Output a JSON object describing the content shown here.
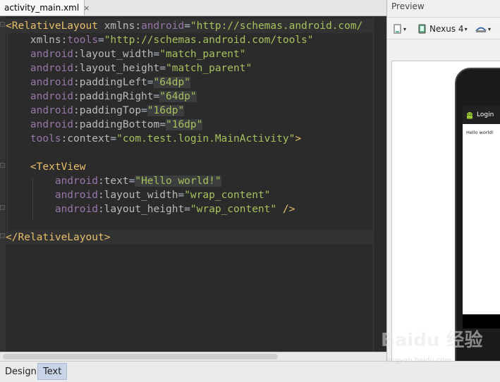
{
  "editor": {
    "tab_label": "activity_main.xml",
    "close_glyph": "×",
    "lines": [
      {
        "parts": [
          [
            "punc",
            "<"
          ],
          [
            "tagname",
            "RelativeLayout"
          ],
          [
            "plain",
            " "
          ],
          [
            "attr",
            "xmlns:"
          ],
          [
            "attr-ns",
            "android"
          ],
          [
            "plain",
            "="
          ],
          [
            "val",
            "\"http://schemas.android.com/"
          ]
        ]
      },
      {
        "parts": [
          [
            "plain",
            "    "
          ],
          [
            "attr",
            "xmlns:"
          ],
          [
            "attr-ns",
            "tools"
          ],
          [
            "plain",
            "="
          ],
          [
            "val",
            "\"http://schemas.android.com/tools\""
          ]
        ]
      },
      {
        "parts": [
          [
            "plain",
            "    "
          ],
          [
            "attr-ns",
            "android"
          ],
          [
            "attr",
            ":layout_width"
          ],
          [
            "plain",
            "="
          ],
          [
            "val",
            "\"match_parent\""
          ]
        ]
      },
      {
        "parts": [
          [
            "plain",
            "    "
          ],
          [
            "attr-ns",
            "android"
          ],
          [
            "attr",
            ":layout_height"
          ],
          [
            "plain",
            "="
          ],
          [
            "val",
            "\"match_parent\""
          ]
        ]
      },
      {
        "parts": [
          [
            "plain",
            "    "
          ],
          [
            "attr-ns",
            "android"
          ],
          [
            "attr",
            ":paddingLeft"
          ],
          [
            "plain",
            "="
          ],
          [
            "val",
            "\"64dp\""
          ]
        ]
      },
      {
        "parts": [
          [
            "plain",
            "    "
          ],
          [
            "attr-ns",
            "android"
          ],
          [
            "attr",
            ":paddingRight"
          ],
          [
            "plain",
            "="
          ],
          [
            "val",
            "\"64dp\""
          ]
        ]
      },
      {
        "parts": [
          [
            "plain",
            "    "
          ],
          [
            "attr-ns",
            "android"
          ],
          [
            "attr",
            ":paddingTop"
          ],
          [
            "plain",
            "="
          ],
          [
            "val",
            "\"16dp\""
          ]
        ]
      },
      {
        "parts": [
          [
            "plain",
            "    "
          ],
          [
            "attr-ns",
            "android"
          ],
          [
            "attr",
            ":paddingBottom"
          ],
          [
            "plain",
            "="
          ],
          [
            "val",
            "\"16dp\""
          ]
        ]
      },
      {
        "parts": [
          [
            "plain",
            "    "
          ],
          [
            "attr-ns",
            "tools"
          ],
          [
            "attr",
            ":context"
          ],
          [
            "plain",
            "="
          ],
          [
            "val",
            "\"com.test.login.MainActivity\""
          ],
          [
            "punc",
            ">"
          ]
        ]
      },
      {
        "parts": [
          [
            "plain",
            " "
          ]
        ]
      },
      {
        "parts": [
          [
            "plain",
            "    "
          ],
          [
            "punc",
            "<"
          ],
          [
            "tagname",
            "TextView"
          ]
        ]
      },
      {
        "parts": [
          [
            "plain",
            "        "
          ],
          [
            "attr-ns",
            "android"
          ],
          [
            "attr",
            ":text"
          ],
          [
            "plain",
            "="
          ],
          [
            "val",
            "\"Hello world!\""
          ]
        ]
      },
      {
        "parts": [
          [
            "plain",
            "        "
          ],
          [
            "attr-ns",
            "android"
          ],
          [
            "attr",
            ":layout_width"
          ],
          [
            "plain",
            "="
          ],
          [
            "val",
            "\"wrap_content\""
          ]
        ]
      },
      {
        "parts": [
          [
            "plain",
            "        "
          ],
          [
            "attr-ns",
            "android"
          ],
          [
            "attr",
            ":layout_height"
          ],
          [
            "plain",
            "="
          ],
          [
            "val",
            "\"wrap_content\""
          ],
          [
            "plain",
            " "
          ],
          [
            "punc",
            "/>"
          ]
        ]
      },
      {
        "parts": [
          [
            "plain",
            " "
          ]
        ]
      },
      {
        "parts": [
          [
            "punc",
            "</"
          ],
          [
            "tagname",
            "RelativeLayout"
          ],
          [
            "punc",
            ">"
          ]
        ]
      }
    ]
  },
  "preview": {
    "title": "Preview",
    "device_label": "Nexus 4",
    "app_title": "Login",
    "hello_text": "Hello world!"
  },
  "bottom_tabs": {
    "design": "Design",
    "text": "Text"
  },
  "watermark": {
    "brand": "Baidu 经验",
    "url": "jingyan.baidu.com"
  },
  "colors": {
    "tag": "#e8bf6a",
    "namespace": "#9876aa",
    "attribute": "#bababa",
    "value": "#a5c25c",
    "editor_bg": "#2b2b2b"
  }
}
